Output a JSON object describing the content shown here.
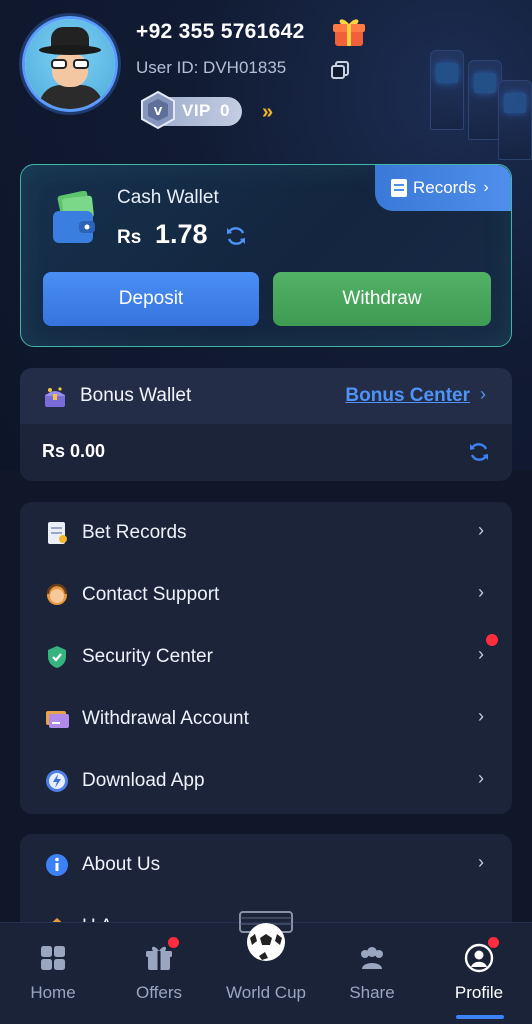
{
  "header": {
    "phone": "+92 355 5761642",
    "user_id": "User ID: DVH01835",
    "vip_label": "VIP",
    "vip_level": "0",
    "vip_arrows": "»"
  },
  "cash_wallet": {
    "title": "Cash Wallet",
    "currency": "Rs",
    "amount": "1.78",
    "records_label": "Records",
    "records_chevron": "›",
    "deposit_label": "Deposit",
    "withdraw_label": "Withdraw"
  },
  "bonus_wallet": {
    "title": "Bonus Wallet",
    "center_link": "Bonus Center",
    "chevron": "›",
    "amount": "Rs 0.00"
  },
  "menu": {
    "chevron": "›",
    "items": [
      {
        "label": "Bet Records",
        "icon": "bet-records-icon"
      },
      {
        "label": "Contact Support",
        "icon": "support-icon"
      },
      {
        "label": "Security Center",
        "icon": "shield-icon"
      },
      {
        "label": "Withdrawal Account",
        "icon": "card-icon"
      },
      {
        "label": "Download App",
        "icon": "download-icon"
      }
    ]
  },
  "about": {
    "label": "About Us",
    "partial_label": "H    A",
    "icon": "info-icon"
  },
  "bottom_nav": {
    "items": [
      {
        "label": "Home",
        "icon": "home-grid-icon"
      },
      {
        "label": "Offers",
        "icon": "gift-icon"
      },
      {
        "label": "World Cup",
        "icon": "soccer-ball-icon"
      },
      {
        "label": "Share",
        "icon": "users-icon"
      },
      {
        "label": "Profile",
        "icon": "profile-icon"
      }
    ],
    "active_index": 4
  },
  "colors": {
    "accent_blue": "#3c82f6",
    "deposit": "#4a8ff5",
    "withdraw": "#52b266",
    "badge_red": "#ff2d3d",
    "card_border": "#3fb6a6"
  }
}
